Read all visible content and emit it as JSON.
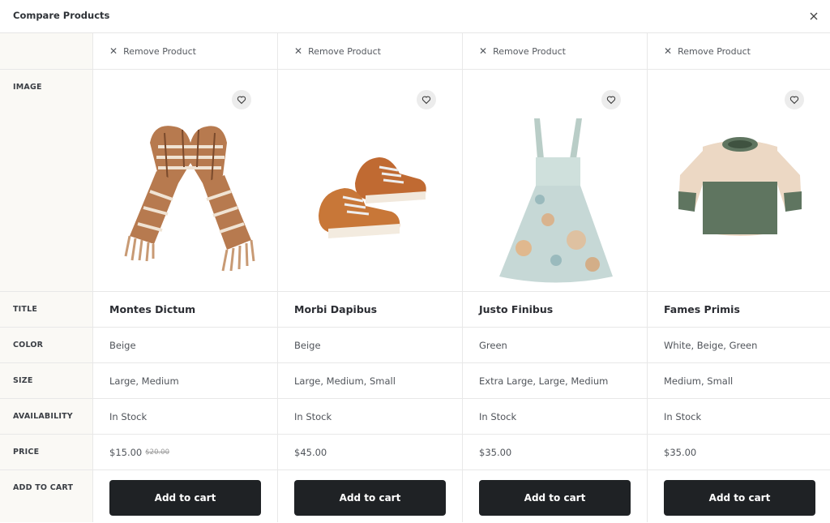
{
  "header": {
    "title": "Compare Products",
    "close_icon": "close-icon"
  },
  "row_labels": {
    "image": "IMAGE",
    "title": "TITLE",
    "color": "COLOR",
    "size": "SIZE",
    "availability": "AVAILABILITY",
    "price": "PRICE",
    "add_to_cart": "ADD TO CART"
  },
  "products": [
    {
      "remove_label": "Remove Product",
      "image_icon": "scarf-image",
      "title": "Montes Dictum",
      "color": "Beige",
      "size": "Large, Medium",
      "availability": "In Stock",
      "price": "$15.00",
      "old_price": "$20.00",
      "cart_label": "Add to cart"
    },
    {
      "remove_label": "Remove Product",
      "image_icon": "shoes-image",
      "title": "Morbi Dapibus",
      "color": "Beige",
      "size": "Large, Medium, Small",
      "availability": "In Stock",
      "price": "$45.00",
      "old_price": "",
      "cart_label": "Add to cart"
    },
    {
      "remove_label": "Remove Product",
      "image_icon": "dress-image",
      "title": "Justo Finibus",
      "color": "Green",
      "size": "Extra Large, Large, Medium",
      "availability": "In Stock",
      "price": "$35.00",
      "old_price": "",
      "cart_label": "Add to cart"
    },
    {
      "remove_label": "Remove Product",
      "image_icon": "sweater-image",
      "title": "Fames Primis",
      "color": "White, Beige, Green",
      "size": "Medium, Small",
      "availability": "In Stock",
      "price": "$35.00",
      "old_price": "",
      "cart_label": "Add to cart"
    }
  ]
}
